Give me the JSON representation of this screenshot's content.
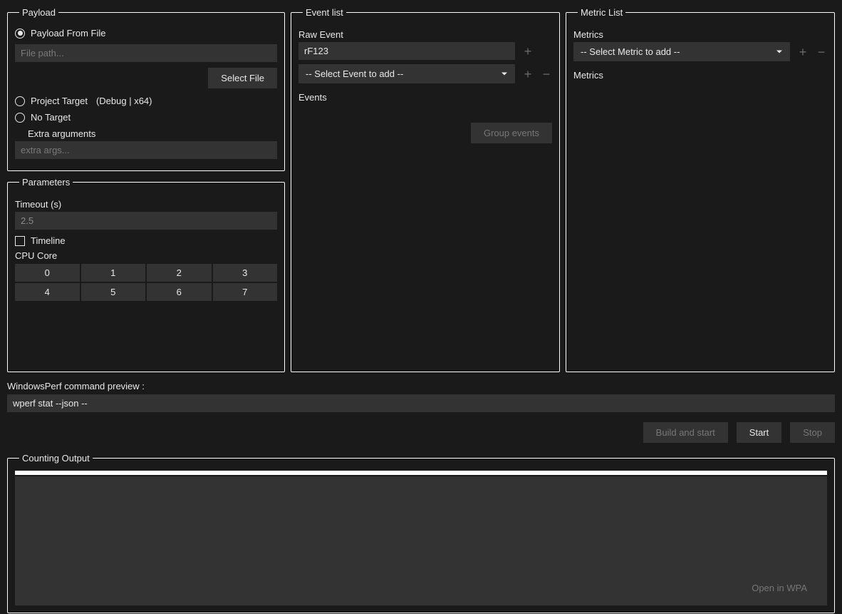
{
  "payload": {
    "legend": "Payload",
    "from_file_label": "Payload From File",
    "file_path_placeholder": "File path...",
    "select_file_btn": "Select File",
    "project_target_label": "Project Target",
    "project_target_suffix": "(Debug | x64)",
    "no_target_label": "No Target",
    "extra_args_label": "Extra arguments",
    "extra_args_placeholder": "extra args..."
  },
  "parameters": {
    "legend": "Parameters",
    "timeout_label": "Timeout (s)",
    "timeout_value": "2.5",
    "timeline_label": "Timeline",
    "cpu_core_label": "CPU Core",
    "cores": [
      "0",
      "1",
      "2",
      "3",
      "4",
      "5",
      "6",
      "7"
    ]
  },
  "events": {
    "legend": "Event list",
    "raw_event_label": "Raw Event",
    "raw_event_value": "rF123",
    "add_event_placeholder": "-- Select Event to add --",
    "events_header": "Events",
    "group_btn": "Group events"
  },
  "metrics": {
    "legend": "Metric List",
    "metrics_label": "Metrics",
    "add_metric_placeholder": "-- Select Metric to add --",
    "metrics_header": "Metrics"
  },
  "preview": {
    "label": "WindowsPerf command preview :",
    "command": "wperf stat --json --"
  },
  "actions": {
    "build_start": "Build and start",
    "start": "Start",
    "stop": "Stop"
  },
  "output": {
    "legend": "Counting Output",
    "open_wpa": "Open in WPA"
  }
}
